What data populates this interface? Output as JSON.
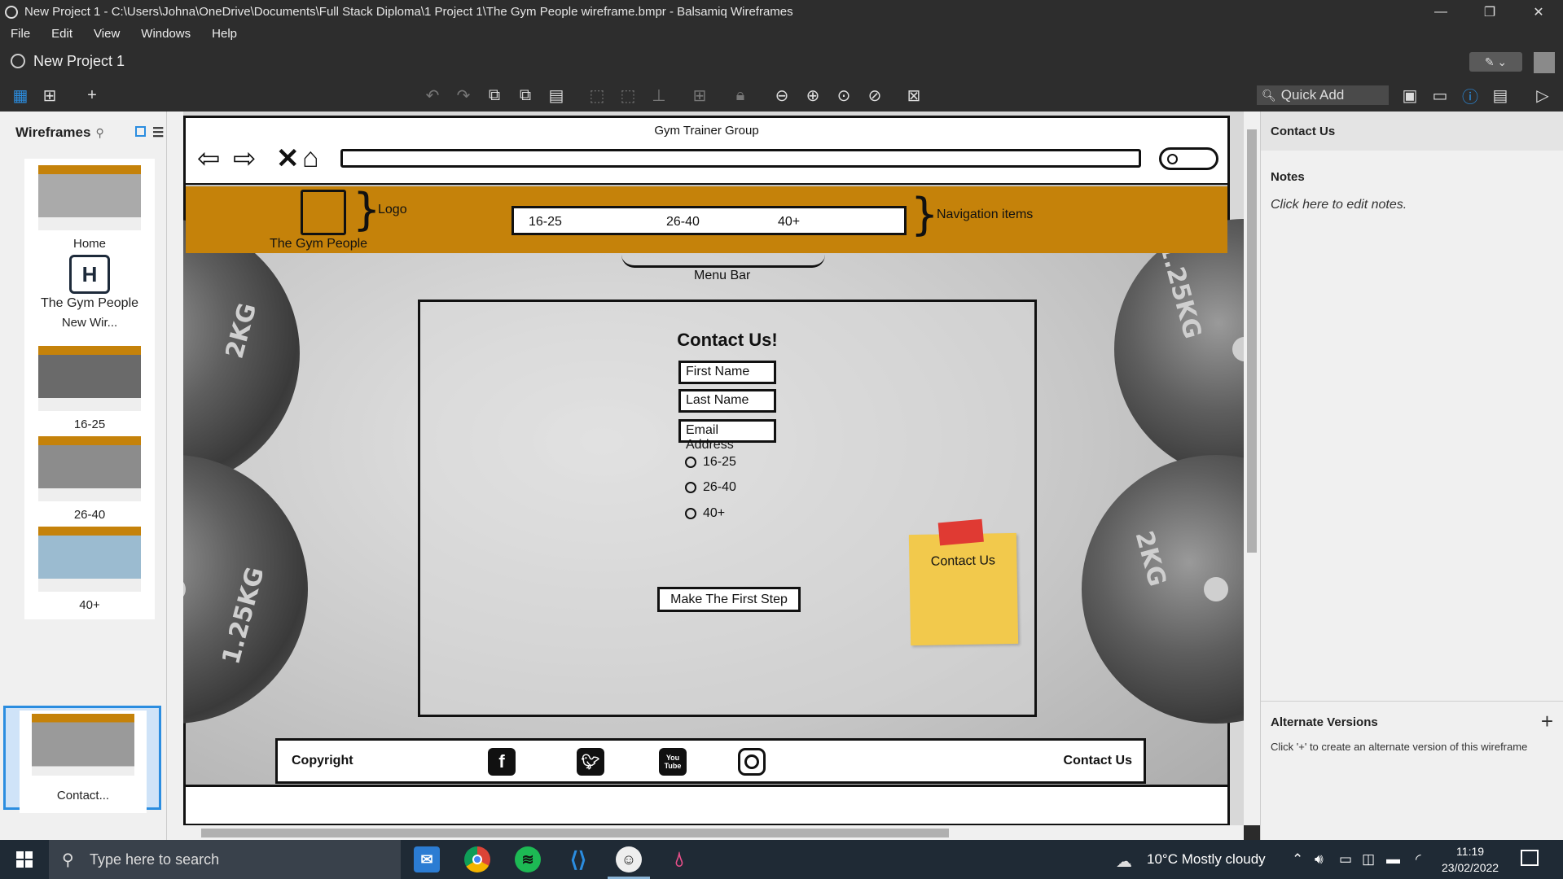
{
  "window": {
    "title": "New Project 1 - C:\\Users\\Johna\\OneDrive\\Documents\\Full Stack Diploma\\1 Project 1\\The Gym People wireframe.bmpr - Balsamiq Wireframes",
    "minimize": "—",
    "restore": "❐",
    "close": "✕"
  },
  "menu": {
    "items": [
      "File",
      "Edit",
      "View",
      "Windows",
      "Help"
    ]
  },
  "project": {
    "title": "New Project 1"
  },
  "toolbar": {
    "quick_add_label": "Quick Add"
  },
  "sidebar": {
    "title": "Wireframes",
    "wireframes": [
      {
        "label": "Home"
      },
      {
        "label": "New Wir...",
        "logo_text": "The Gym People"
      },
      {
        "label": "16-25"
      },
      {
        "label": "26-40"
      },
      {
        "label": "40+"
      },
      {
        "label": "Contact..."
      }
    ]
  },
  "mockup": {
    "browser_title": "Gym Trainer Group",
    "logo_annotation": "Logo",
    "brand_name": "The Gym People",
    "nav_items": [
      "16-25",
      "26-40",
      "40+"
    ],
    "nav_annotation": "Navigation items",
    "menu_annotation": "Menu Bar",
    "form": {
      "title": "Contact Us!",
      "first_name": "First Name",
      "last_name": "Last Name",
      "email": "Email Address",
      "radio_options": [
        "16-25",
        "26-40",
        "40+"
      ],
      "submit": "Make The First Step"
    },
    "sticky_note": "Contact Us",
    "plate_labels": [
      "2KG",
      "1.25KG",
      "1.25KG",
      "2KG"
    ],
    "footer": {
      "copyright": "Copyright",
      "contact": "Contact Us",
      "youtube_label": "You Tube"
    }
  },
  "rightpanel": {
    "title": "Contact Us",
    "notes_heading": "Notes",
    "notes_placeholder": "Click here to edit notes.",
    "alt_heading": "Alternate Versions",
    "alt_hint": "Click '+' to create an alternate version of this wireframe"
  },
  "taskbar": {
    "search_placeholder": "Type here to search",
    "weather": "10°C  Mostly cloudy",
    "time": "11:19",
    "date": "23/02/2022"
  },
  "colors": {
    "header_band": "#c5820a",
    "sticky_note": "#f2c94c",
    "sticky_tape": "#e03a33",
    "accent": "#2b8de0"
  }
}
